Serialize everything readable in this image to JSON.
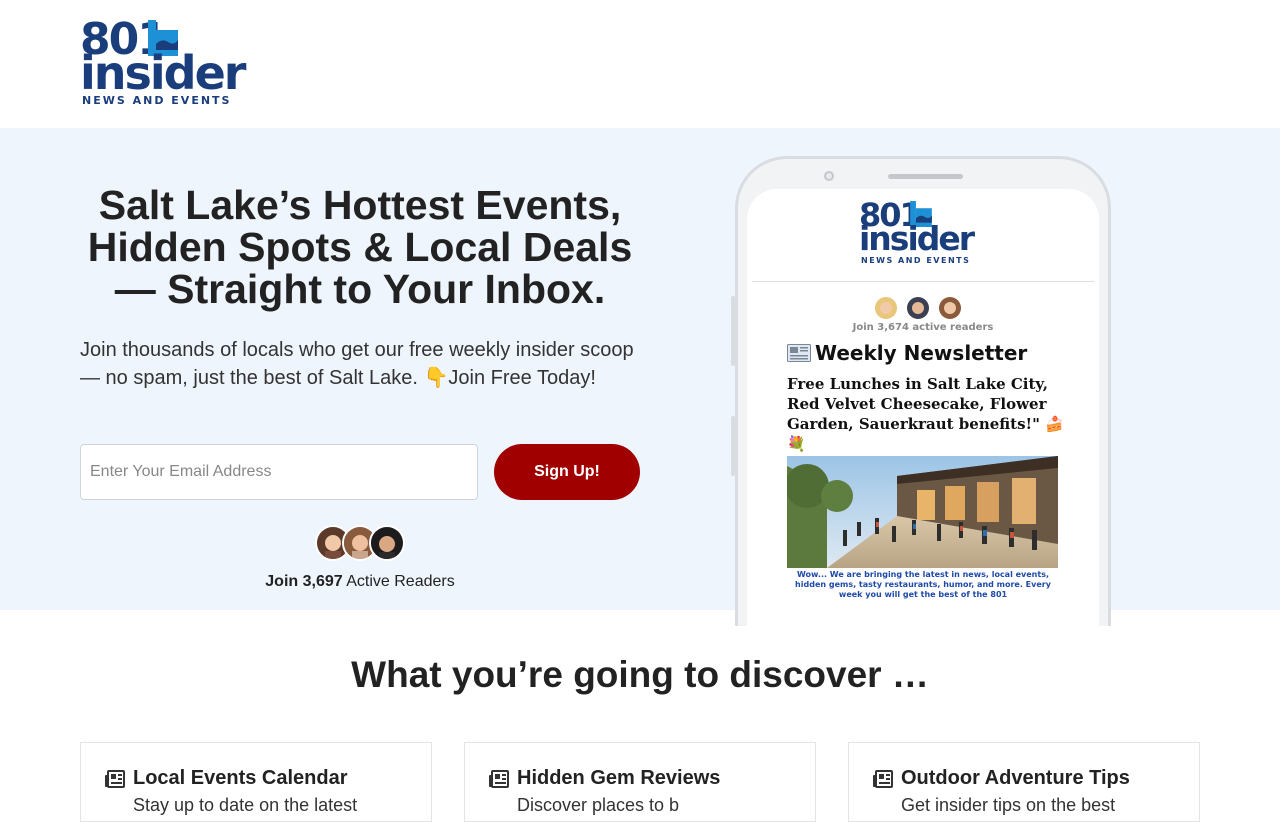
{
  "header": {
    "logo": {
      "top": "801",
      "word": "insider",
      "tagline": "NEWS AND EVENTS"
    }
  },
  "hero": {
    "title": "Salt Lake’s Hottest Events, Hidden Spots & Local Deals — Straight to Your Inbox.",
    "subtitle": "Join thousands of locals who get our free weekly insider scoop — no spam, just the best of Salt Lake.  👇Join Free Today!",
    "email_placeholder": "Enter Your Email Address",
    "signup_label": "Sign Up!",
    "readers_prefix": "Join 3,697",
    "readers_suffix": " Active Readers"
  },
  "phone": {
    "readers_prefix": "Join 3,674",
    "readers_suffix": " active readers",
    "newsletter_title": "Weekly Newsletter",
    "headline": "Free Lunches in Salt Lake City,  Red Velvet Cheesecake, Flower Garden, Sauerkraut benefits!\" 🍰💐",
    "caption": "Wow... We are bringing  the latest in news, local events, hidden gems, tasty restaurants, humor, and more.  Every week you will get the best of the 801"
  },
  "discover": {
    "title": "What you’re going to discover …",
    "cards": [
      {
        "title": "Local Events Calendar",
        "desc": "Stay up to date on the latest"
      },
      {
        "title": "Hidden Gem Reviews",
        "desc": "Discover places to b"
      },
      {
        "title": "Outdoor Adventure Tips",
        "desc": "Get insider tips on the best"
      }
    ]
  },
  "colors": {
    "brand_blue": "#1a3d7c",
    "accent_blue": "#1e90d6",
    "cta_red": "#a00000",
    "hero_bg": "#eff5fd"
  },
  "icons": [
    "newspaper-icon",
    "avatar"
  ]
}
